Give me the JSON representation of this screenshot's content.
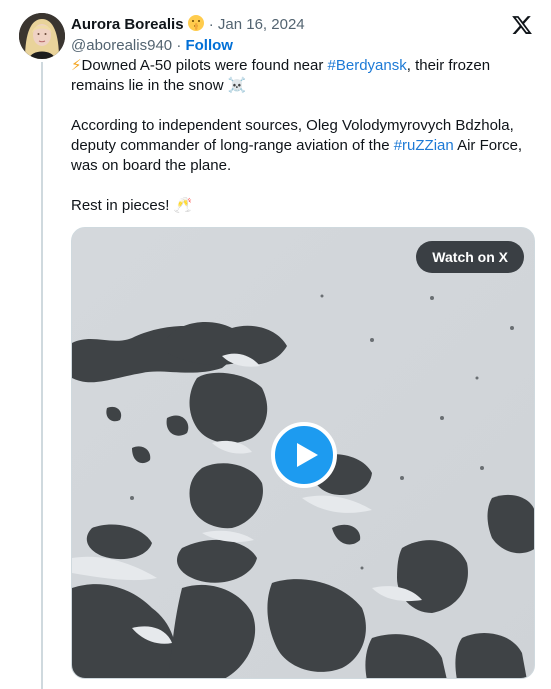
{
  "author": {
    "name": "Aurora Borealis",
    "name_emoji": "shushing-face-emoji",
    "separator": "·",
    "date": "Jan 16, 2024",
    "handle": "@aborealis940",
    "handle_separator": "·",
    "follow_label": "Follow"
  },
  "tweet": {
    "p1_emoji": "⚡",
    "p1_before": "Downed A-50 pilots were found near ",
    "p1_hashtag": "#Berdyansk",
    "p1_after": ", their frozen remains lie in the snow ",
    "p1_end_emoji": "☠️",
    "p2_before": "According to independent sources, Oleg Volodymyrovych Bdzhola, deputy commander of long-range aviation of the ",
    "p2_hashtag": "#ruZZian",
    "p2_after": " Air Force, was on board the plane.",
    "p3_text": "Rest in pieces! ",
    "p3_emoji": "🥂"
  },
  "media": {
    "watch_label": "Watch on X",
    "play_icon": "play-icon"
  },
  "colors": {
    "link": "#1d7ad6",
    "follow": "#006fd6",
    "muted": "#536471",
    "play": "#1d9bf0"
  }
}
